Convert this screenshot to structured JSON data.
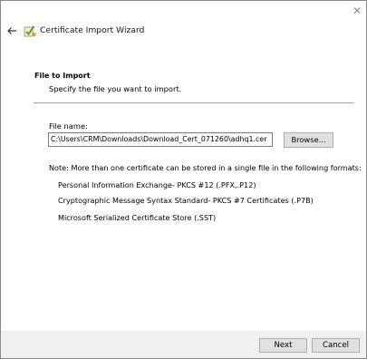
{
  "window": {
    "close_glyph": "✕",
    "title": "Certificate Import Wizard"
  },
  "section": {
    "title": "File to Import",
    "subtitle": "Specify the file you want to import."
  },
  "file": {
    "label": "File name:",
    "value": "C:\\Users\\CRM\\Downloads\\Download_Cert_071260\\adhq1.cer",
    "browse_label": "Browse..."
  },
  "note": {
    "text": "Note:  More than one certificate can be stored in a single file in the following formats:",
    "formats": [
      "Personal Information Exchange- PKCS #12 (.PFX,.P12)",
      "Cryptographic Message Syntax Standard- PKCS #7 Certificates (.P7B)",
      "Microsoft Serialized Certificate Store (.SST)"
    ]
  },
  "footer": {
    "next_label": "Next",
    "cancel_label": "Cancel"
  },
  "colors": {
    "footer_bg": "#f0f0f0",
    "button_bg": "#e1e1e1",
    "icon_green": "#5aa02c"
  },
  "icons": {
    "back": "arrow-left-icon",
    "wizard": "certificate-wizard-icon",
    "close": "close-icon"
  }
}
